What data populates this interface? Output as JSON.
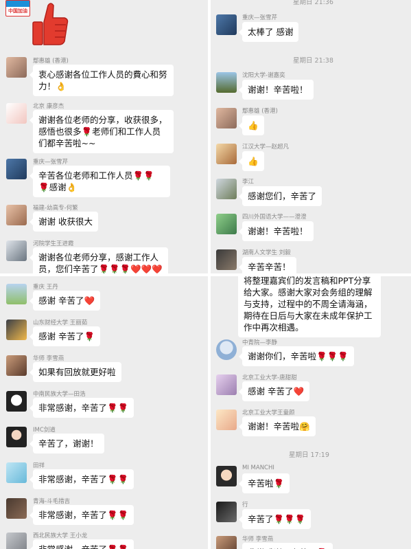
{
  "pane_a": {
    "badge": "中国加油",
    "messages": [
      {
        "name": "鄢惠雄 (香港)",
        "text": "衷心感谢各位工作人员的費心和努力！👌"
      },
      {
        "name": "北京 康彦杰",
        "text": "谢谢各位老师的分享，收获很多，感悟也很多🌹老师们和工作人员们都辛苦啦~~"
      },
      {
        "name": "重庆—张雪芹",
        "text": "辛苦各位老师和工作人员🌹🌹🌹感谢👌"
      },
      {
        "name": "福建-幼高专-何繁",
        "text": "谢谢 收获很大"
      },
      {
        "name": "河院学生王进霞",
        "text": "谢谢各位老师分享，感谢工作人员，您们辛苦了🌹🌹🌹❤️❤️❤️"
      }
    ]
  },
  "pane_b": {
    "messages": [
      {
        "name": "重庆  王丹",
        "text": "感谢 辛苦了❤️"
      },
      {
        "name": "山东财经大学 王丽茹",
        "text": "感谢 辛苦了🌹"
      },
      {
        "name": "华师  李雪燕",
        "text": "如果有回放就更好啦"
      },
      {
        "name": "中南民族大学—田浩",
        "text": "非常感谢，辛苦了🌹🌹"
      },
      {
        "name": "IMC剑道",
        "text": "辛苦了，谢谢！"
      },
      {
        "name": "田祥",
        "text": "非常感谢，辛苦了🌹🌹"
      },
      {
        "name": "青海-斗毛措吉",
        "text": "非常感谢，辛苦了🌹🌹"
      },
      {
        "name": "西北民族大学  王小龙",
        "text": "非常感谢，辛苦了🌹🌹"
      }
    ]
  },
  "pane_c": {
    "top_time": "星期日 21:36",
    "time2": "星期日 21:38",
    "messages": [
      {
        "name": "重庆—张雪芹",
        "text": "太棒了 感谢"
      },
      {
        "name": "沈阳大学-谢嘉奕",
        "text": "谢谢！辛苦啦！"
      },
      {
        "name": "鄢惠雄 (香港)",
        "text": "👍"
      },
      {
        "name": "江汉大学—赵超凡",
        "text": "👍"
      },
      {
        "name": "李江",
        "text": "感谢您们，辛苦了"
      },
      {
        "name": "四川外国语大学——澄澄",
        "text": "谢谢！辛苦啦！"
      },
      {
        "name": "湖南人文学生 刘毅",
        "text": "辛苦辛苦！"
      }
    ]
  },
  "pane_d": {
    "announcement": "将整理嘉宾们的发言稿和PPT分享给大家。感谢大家对会务组的理解与支持，过程中的不周全请海涵，期待在日后与大家在未成年保护工作中再次相遇。",
    "time": "星期日 17:19",
    "messages": [
      {
        "name": "中青院—李静",
        "text": "谢谢你们，辛苦啦🌹🌹🌹"
      },
      {
        "name": "北京工业大学-唐甜甜",
        "text": "感谢 辛苦了❤️"
      },
      {
        "name": "北京工业大学王童颜",
        "text": "谢谢！辛苦啦🤗"
      },
      {
        "name": "MI MANCHI",
        "text": "辛苦啦🌹"
      },
      {
        "name": "行",
        "text": "辛苦了🌹🌹🌹"
      },
      {
        "name": "华师  李雪燕",
        "text": "非常感谢，辛苦了🌹"
      }
    ]
  },
  "colors": {
    "chat_bg": "#ededed",
    "bubble": "#ffffff",
    "rose": "#d21f2b",
    "thumb": "#e23b2e"
  }
}
